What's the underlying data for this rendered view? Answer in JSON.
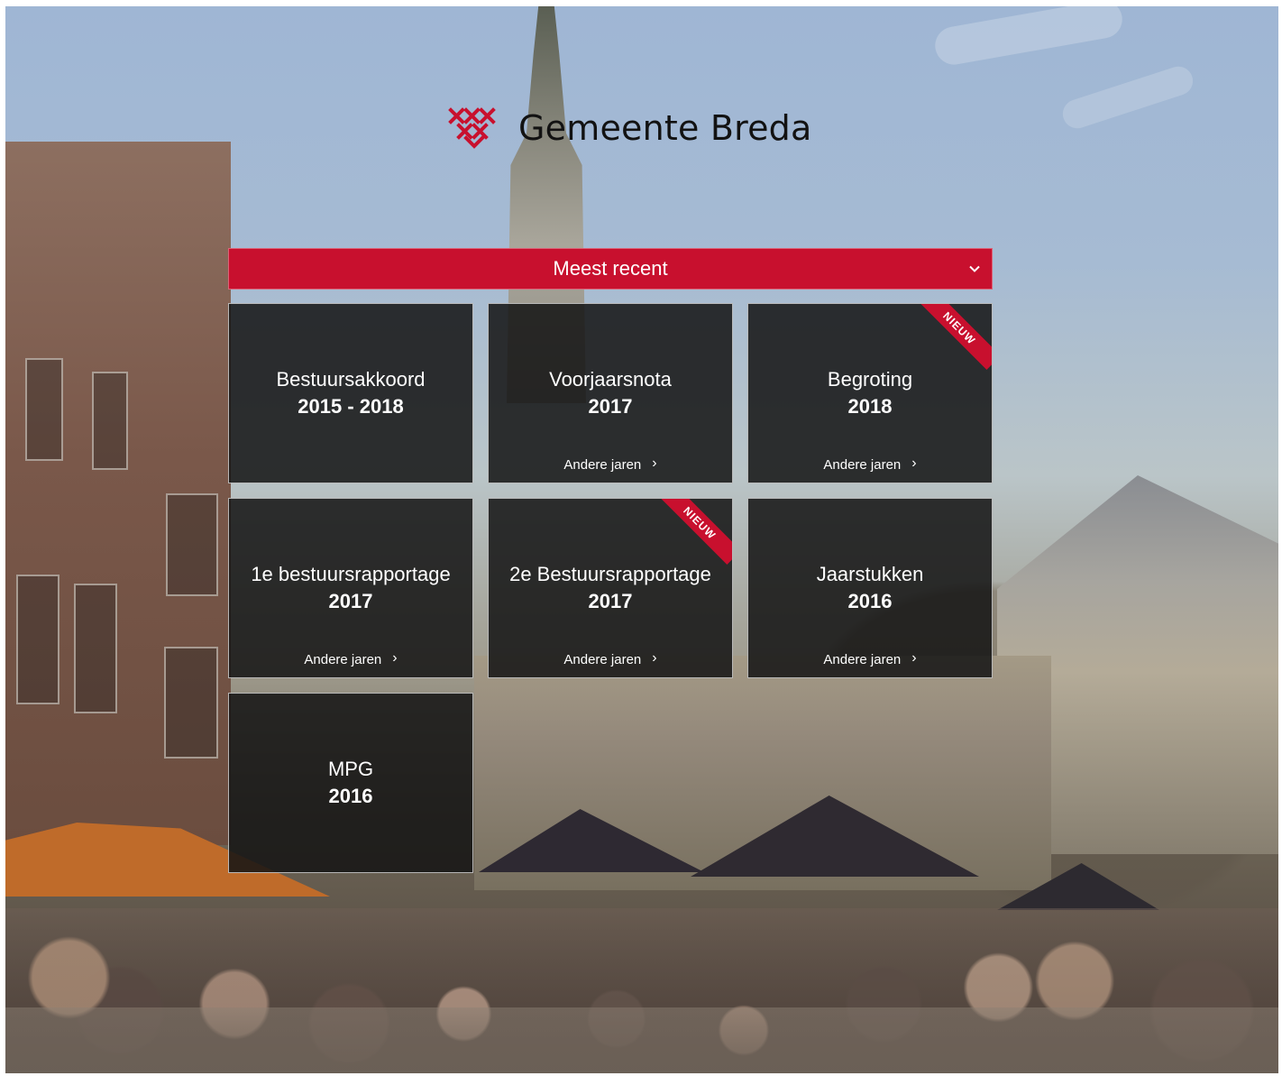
{
  "brand": {
    "logo_icon": "gemeente-breda-logo-icon",
    "title": "Gemeente Breda"
  },
  "filter": {
    "selected": "Meest recent",
    "chevron_icon": "chevron-down-icon"
  },
  "tiles": [
    {
      "title": "Bestuursakkoord",
      "year": "2015 - 2018",
      "link": "",
      "badge": ""
    },
    {
      "title": "Voorjaarsnota",
      "year": "2017",
      "link": "Andere jaren",
      "badge": ""
    },
    {
      "title": "Begroting",
      "year": "2018",
      "link": "Andere jaren",
      "badge": "NIEUW"
    },
    {
      "title": "1e bestuursrapportage",
      "year": "2017",
      "link": "Andere jaren",
      "badge": ""
    },
    {
      "title": "2e Bestuursrapportage",
      "year": "2017",
      "link": "Andere jaren",
      "badge": "NIEUW"
    },
    {
      "title": "Jaarstukken",
      "year": "2016",
      "link": "Andere jaren",
      "badge": ""
    },
    {
      "title": "MPG",
      "year": "2016",
      "link": "",
      "badge": ""
    }
  ],
  "colors": {
    "accent": "#c8102e",
    "tile_background": "#141414",
    "text_on_dark": "#ffffff",
    "brand_text": "#121212"
  }
}
